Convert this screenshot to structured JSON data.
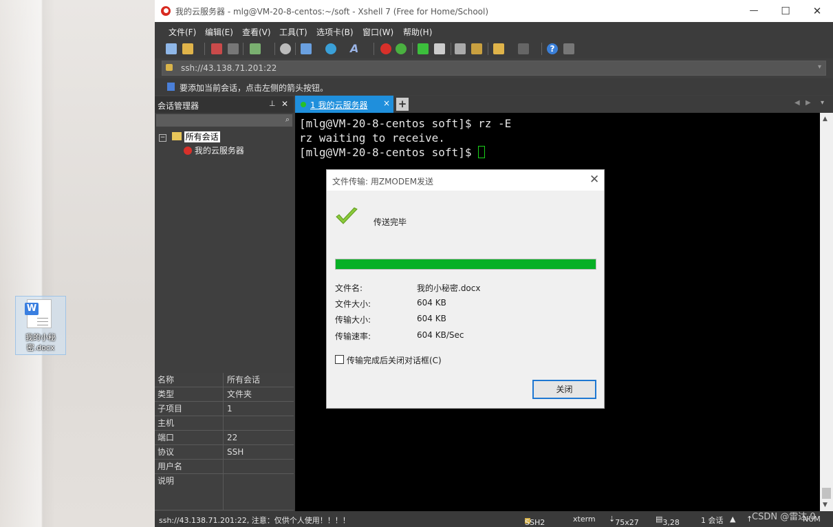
{
  "desktop": {
    "icon_label": "我的小秘密.docx"
  },
  "window": {
    "title": "我的云服务器 - mlg@VM-20-8-centos:~/soft - Xshell 7 (Free for Home/School)",
    "minimize": "—",
    "maximize": "☐",
    "close": "✕"
  },
  "menu": [
    "文件(F)",
    "编辑(E)",
    "查看(V)",
    "工具(T)",
    "选项卡(B)",
    "窗口(W)",
    "帮助(H)"
  ],
  "address": "ssh://43.138.71.201:22",
  "hint": "要添加当前会话，点击左侧的箭头按钮。",
  "session_panel": {
    "title": "会话管理器",
    "pin": "⊥",
    "close": "✕",
    "tree_root": "所有会话",
    "tree_child": "我的云服务器",
    "properties": [
      {
        "key": "名称",
        "value": "所有会话"
      },
      {
        "key": "类型",
        "value": "文件夹"
      },
      {
        "key": "子项目",
        "value": "1"
      },
      {
        "key": "主机",
        "value": ""
      },
      {
        "key": "端口",
        "value": "22"
      },
      {
        "key": "协议",
        "value": "SSH"
      },
      {
        "key": "用户名",
        "value": ""
      },
      {
        "key": "说明",
        "value": ""
      }
    ]
  },
  "tab": {
    "label": "1 我的云服务器",
    "close": "×",
    "add": "+"
  },
  "terminal": {
    "lines": [
      "[mlg@VM-20-8-centos soft]$ rz -E",
      "rz waiting to receive.",
      "[mlg@VM-20-8-centos soft]$ "
    ]
  },
  "dialog": {
    "title": "文件传输: 用ZMODEM发送",
    "close": "✕",
    "status": "传送完毕",
    "progress": 1.0,
    "rows": [
      {
        "label": "文件名:",
        "value": "我的小秘密.docx"
      },
      {
        "label": "文件大小:",
        "value": "604 KB"
      },
      {
        "label": "传输大小:",
        "value": "604 KB"
      },
      {
        "label": "传输速率:",
        "value": "604 KB/Sec"
      }
    ],
    "checkbox_label": "传输完成后关闭对话框(C)",
    "button": "关闭"
  },
  "statusbar": {
    "text": "ssh://43.138.71.201:22, 注意：仅供个人使用！！！！",
    "protocol": "SSH2",
    "term": "xterm",
    "size": "75x27",
    "pos": "3,28",
    "sessions": "1 会话",
    "num": "NUM"
  },
  "watermark": "CSDN @雷达.0"
}
